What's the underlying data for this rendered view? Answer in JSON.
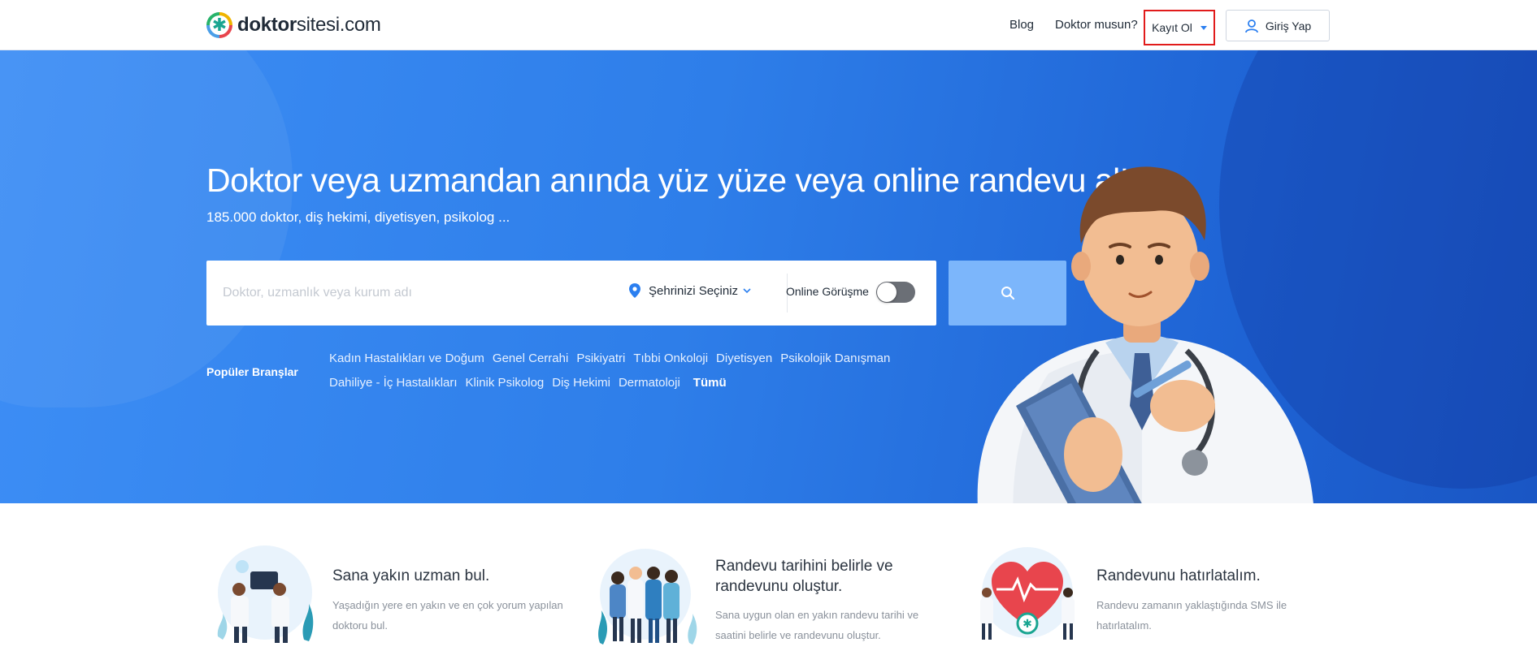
{
  "header": {
    "logo": {
      "bold": "doktor",
      "rest": "sitesi.com"
    },
    "nav": {
      "blog": "Blog",
      "doctor_question": "Doktor musun?",
      "register": "Kayıt Ol",
      "login": "Giriş Yap"
    }
  },
  "hero": {
    "title": "Doktor veya uzmandan anında yüz yüze veya online randevu al!",
    "subtitle": "185.000 doktor, diş hekimi, diyetisyen, psikolog ...",
    "search": {
      "placeholder": "Doktor, uzmanlık veya kurum adı",
      "city_label": "Şehrinizi Seçiniz",
      "online_label": "Online Görüşme",
      "online_enabled": false
    },
    "popular": {
      "label": "Popüler Branşlar",
      "row1": [
        "Kadın Hastalıkları ve Doğum",
        "Genel Cerrahi",
        "Psikiyatri",
        "Tıbbi Onkoloji",
        "Diyetisyen",
        "Psikolojik Danışman"
      ],
      "row2": [
        "Dahiliye - İç Hastalıkları",
        "Klinik Psikolog",
        "Diş Hekimi",
        "Dermatoloji"
      ],
      "all": "Tümü"
    }
  },
  "features": [
    {
      "title": "Sana yakın uzman bul.",
      "desc": "Yaşadığın yere en yakın ve en çok yorum yapılan doktoru bul."
    },
    {
      "title": "Randevu tarihini belirle ve randevunu oluştur.",
      "desc": "Sana uygun olan en yakın randevu tarihi ve saatini belirle ve randevunu oluştur."
    },
    {
      "title": "Randevunu hatırlatalım.",
      "desc": "Randevu zamanın yaklaştığında SMS ile hatırlatalım."
    }
  ],
  "colors": {
    "accent": "#2b7ff0",
    "hero_bg": "#2e7ee9",
    "search_button": "#7cb6fb",
    "highlight_border": "#e11b1b"
  }
}
